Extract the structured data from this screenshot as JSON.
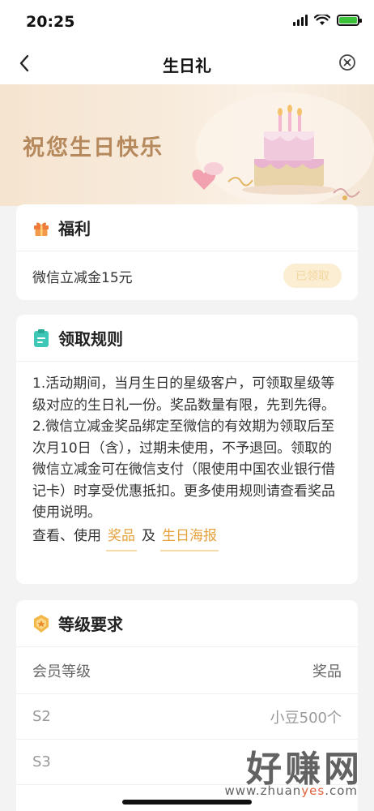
{
  "status_bar": {
    "time": "20:25"
  },
  "nav": {
    "title": "生日礼"
  },
  "banner": {
    "title": "祝您生日快乐"
  },
  "benefit": {
    "title": "福利",
    "item_name": "微信立减金15元",
    "button_label": "已领取"
  },
  "rules": {
    "title": "领取规则",
    "paragraph1": "1.活动期间，当月生日的星级客户，可领取星级等级对应的生日礼一份。奖品数量有限，先到先得。",
    "paragraph2": "2.微信立减金奖品绑定至微信的有效期为领取后至次月10日（含），过期未使用，不予退回。领取的微信立减金可在微信支付（限使用中国农业银行借记卡）时享受优惠抵扣。更多使用规则请查看奖品使用说明。",
    "link_prefix": "查看、使用",
    "link1": "奖品",
    "link_mid": "及",
    "link2": "生日海报"
  },
  "level": {
    "title": "等级要求",
    "col_left": "会员等级",
    "col_right": "奖品",
    "rows": [
      {
        "level": "S2",
        "prize": "小豆500个"
      },
      {
        "level": "S3",
        "prize": ""
      }
    ]
  },
  "watermark": {
    "big": "好赚网",
    "small_a": "www.zhuan",
    "small_hl": "yes",
    "small_b": ".com"
  }
}
